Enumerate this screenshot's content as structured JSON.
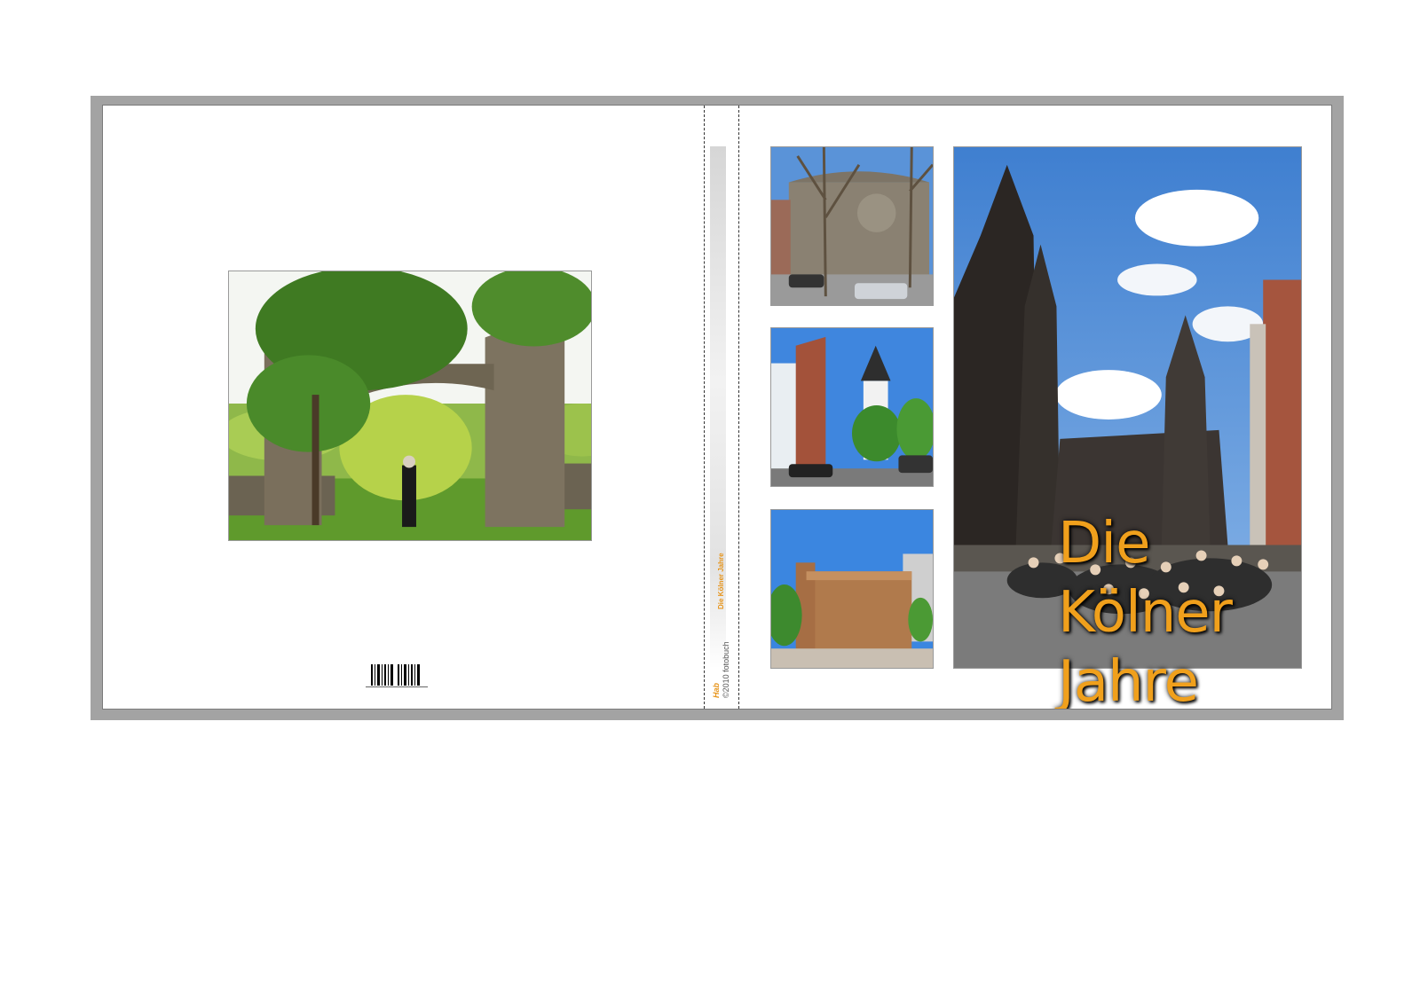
{
  "cover": {
    "title_lines": [
      "Die",
      "Kölner",
      "Jahre"
    ],
    "spine_title": "Die Kölner Jahre",
    "spine_publisher": "©2010 fotobuch",
    "spine_logo": "Hab"
  },
  "colors": {
    "frame": "#a3a3a3",
    "title_orange": "#f0a01c",
    "sky_blue": "#4f8fd6"
  },
  "images": {
    "back": "ruined-stone-arch-with-tree-photo",
    "thumb_1": "modern-church-with-bare-trees-photo",
    "thumb_2": "brick-tower-and-white-steeple-photo",
    "thumb_3": "round-brick-building-photo",
    "front": "cologne-cathedral-group-photo"
  },
  "barcode": "barcode-icon"
}
